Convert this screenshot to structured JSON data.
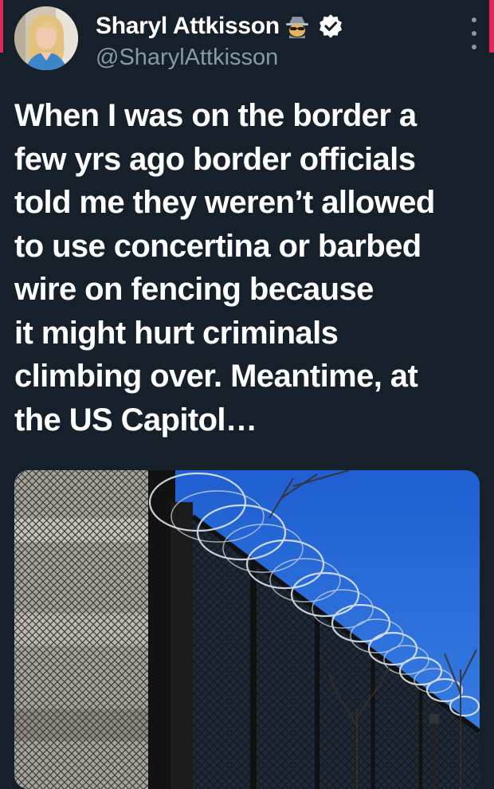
{
  "tweet": {
    "author": {
      "display_name": "Sharyl Attkisson",
      "handle": "@SharylAttkisson",
      "badge_icon": "spy-emoji-icon",
      "verified_icon": "verified-badge-icon"
    },
    "text": "When I was on the border a\nfew yrs ago border officials\ntold me they weren’t allowed\nto use concertina or barbed\nwire on fencing because\nit might hurt criminals\nclimbing over. Meantime, at\nthe US Capitol…",
    "media": {
      "kind": "photo"
    },
    "more_icon": "more-vertical-icon"
  },
  "colors": {
    "background": "#15202b",
    "text": "#ffffff",
    "secondary_text": "#8899a6",
    "verified": "#ffffff",
    "edge_accent": "#e0245e"
  }
}
